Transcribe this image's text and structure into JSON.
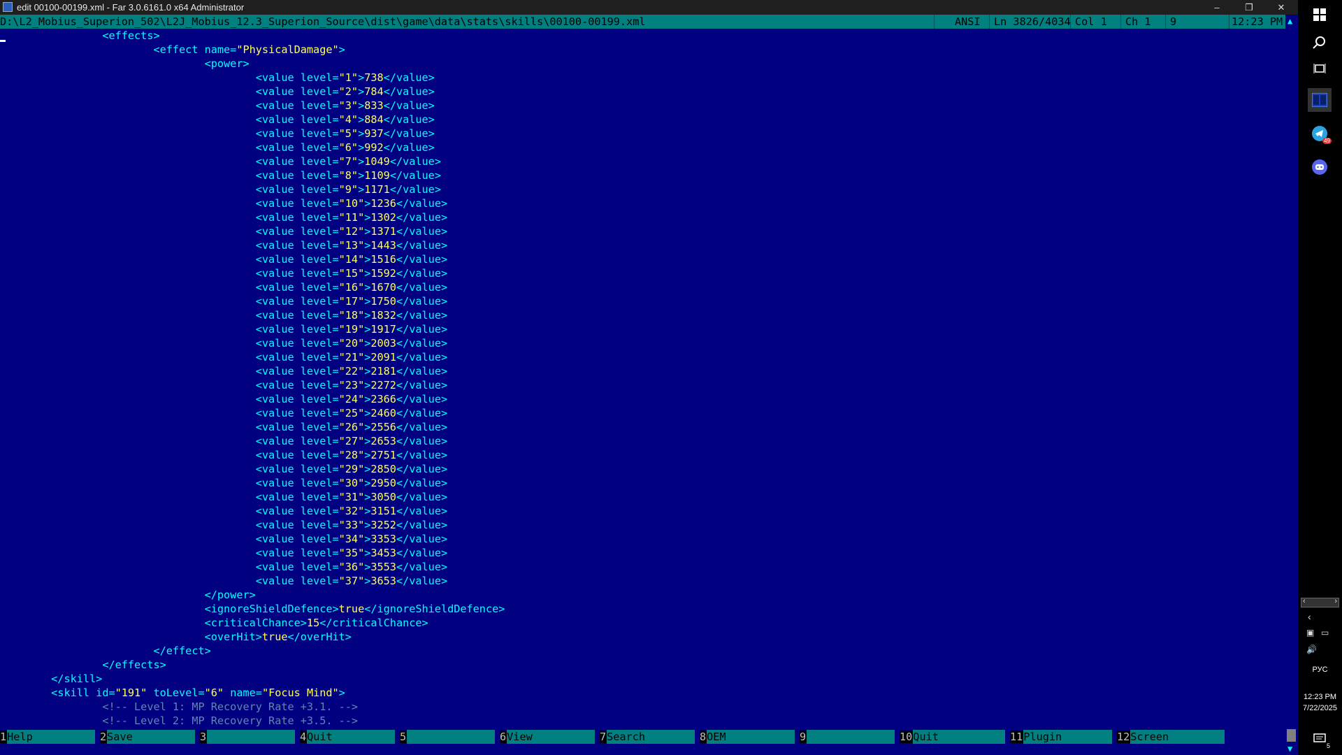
{
  "window": {
    "title": "edit 00100-00199.xml - Far 3.0.6161.0 x64 Administrator",
    "minimize_icon": "minimize-icon",
    "restore_icon": "restore-icon",
    "close_icon": "close-icon"
  },
  "status": {
    "path": "D:\\L2_Mobius_Superion_502\\L2J_Mobius_12.3_Superion_Source\\dist\\game\\data\\stats\\skills\\00100-00199.xml",
    "encoding": "ANSI",
    "line": "Ln 3826/4034",
    "col": "Col 1",
    "ch": "Ch 1",
    "extra": "9",
    "time": "12:23 PM"
  },
  "editor": {
    "l1": "<effects>",
    "l2_open": "<effect ",
    "l2_attr": "name=",
    "l2_val": "\"PhysicalDamage\"",
    "l2_close": ">",
    "l3": "<power>",
    "values": [
      {
        "level": "\"1\"",
        "v": "738"
      },
      {
        "level": "\"2\"",
        "v": "784"
      },
      {
        "level": "\"3\"",
        "v": "833"
      },
      {
        "level": "\"4\"",
        "v": "884"
      },
      {
        "level": "\"5\"",
        "v": "937"
      },
      {
        "level": "\"6\"",
        "v": "992"
      },
      {
        "level": "\"7\"",
        "v": "1049"
      },
      {
        "level": "\"8\"",
        "v": "1109"
      },
      {
        "level": "\"9\"",
        "v": "1171"
      },
      {
        "level": "\"10\"",
        "v": "1236"
      },
      {
        "level": "\"11\"",
        "v": "1302"
      },
      {
        "level": "\"12\"",
        "v": "1371"
      },
      {
        "level": "\"13\"",
        "v": "1443"
      },
      {
        "level": "\"14\"",
        "v": "1516"
      },
      {
        "level": "\"15\"",
        "v": "1592"
      },
      {
        "level": "\"16\"",
        "v": "1670"
      },
      {
        "level": "\"17\"",
        "v": "1750"
      },
      {
        "level": "\"18\"",
        "v": "1832"
      },
      {
        "level": "\"19\"",
        "v": "1917"
      },
      {
        "level": "\"20\"",
        "v": "2003"
      },
      {
        "level": "\"21\"",
        "v": "2091"
      },
      {
        "level": "\"22\"",
        "v": "2181"
      },
      {
        "level": "\"23\"",
        "v": "2272"
      },
      {
        "level": "\"24\"",
        "v": "2366"
      },
      {
        "level": "\"25\"",
        "v": "2460"
      },
      {
        "level": "\"26\"",
        "v": "2556"
      },
      {
        "level": "\"27\"",
        "v": "2653"
      },
      {
        "level": "\"28\"",
        "v": "2751"
      },
      {
        "level": "\"29\"",
        "v": "2850"
      },
      {
        "level": "\"30\"",
        "v": "2950"
      },
      {
        "level": "\"31\"",
        "v": "3050"
      },
      {
        "level": "\"32\"",
        "v": "3151"
      },
      {
        "level": "\"33\"",
        "v": "3252"
      },
      {
        "level": "\"34\"",
        "v": "3353"
      },
      {
        "level": "\"35\"",
        "v": "3453"
      },
      {
        "level": "\"36\"",
        "v": "3553"
      },
      {
        "level": "\"37\"",
        "v": "3653"
      }
    ],
    "value_open": "<value ",
    "value_attr": "level=",
    "value_close_tag": "</value>",
    "power_close": "</power>",
    "ignore_open": "<ignoreShieldDefence>",
    "ignore_val": "true",
    "ignore_close": "</ignoreShieldDefence>",
    "crit_open": "<criticalChance>",
    "crit_val": "15",
    "crit_close": "</criticalChance>",
    "over_open": "<overHit>",
    "over_val": "true",
    "over_close": "</overHit>",
    "effect_close": "</effect>",
    "effects_close": "</effects>",
    "skill_close": "</skill>",
    "skill_open": "<skill ",
    "skill_id_attr": "id=",
    "skill_id_val": "\"191\"",
    "skill_tolevel_attr": " toLevel=",
    "skill_tolevel_val": "\"6\"",
    "skill_name_attr": " name=",
    "skill_name_val": "\"Focus Mind\"",
    "skill_end": ">",
    "comment1": "<!-- Level 1: MP Recovery Rate +3.1. -->",
    "comment2": "<!-- Level 2: MP Recovery Rate +3.5. -->"
  },
  "keybar": [
    {
      "num": "1",
      "label": "Help"
    },
    {
      "num": "2",
      "label": "Save"
    },
    {
      "num": "3",
      "label": ""
    },
    {
      "num": "4",
      "label": "Quit"
    },
    {
      "num": "5",
      "label": ""
    },
    {
      "num": "6",
      "label": "View"
    },
    {
      "num": "7",
      "label": "Search"
    },
    {
      "num": "8",
      "label": "OEM"
    },
    {
      "num": "9",
      "label": ""
    },
    {
      "num": "10",
      "label": "Quit"
    },
    {
      "num": "11",
      "label": "Plugin"
    },
    {
      "num": "12",
      "label": "Screen"
    }
  ],
  "taskbar": {
    "language": "РУС",
    "time": "12:23 PM",
    "date": "7/22/2025",
    "telegram_badge": "49",
    "notification_badge": "5"
  }
}
